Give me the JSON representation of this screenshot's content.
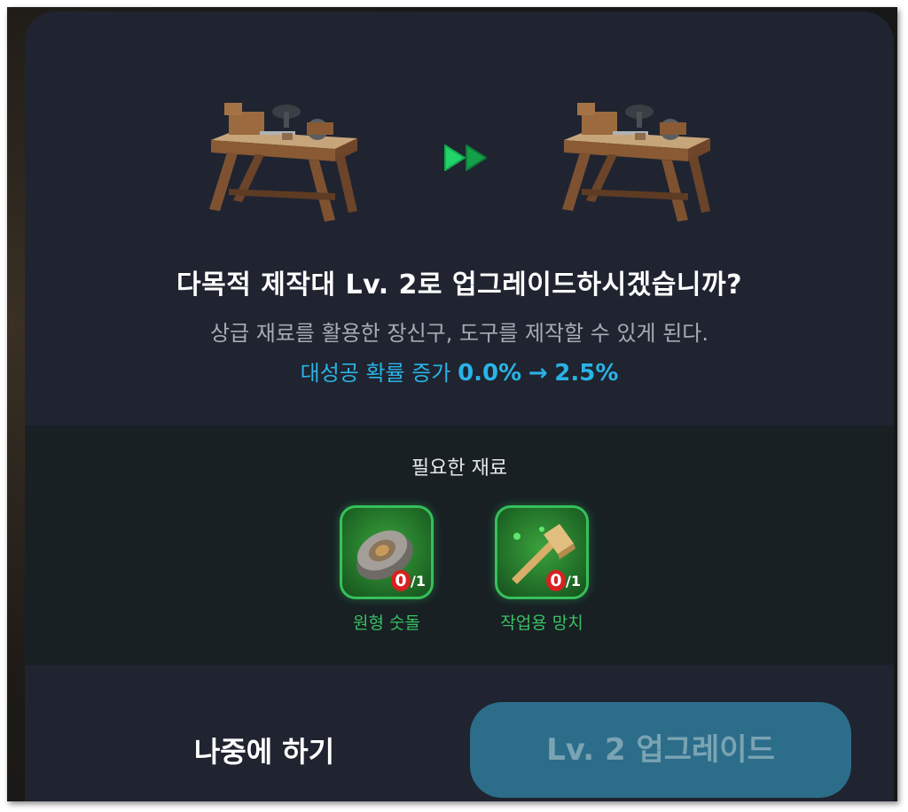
{
  "upgrade": {
    "title": "다목적 제작대 Lv. 2로 업그레이드하시겠습니까?",
    "description": "상급 재료를 활용한 장신구, 도구를 제작할 수 있게 된다.",
    "bonus_label": "대성공 확률 증가",
    "bonus_from": "0.0%",
    "bonus_arrow": "→",
    "bonus_to": "2.5%"
  },
  "materials": {
    "title": "필요한 재료",
    "items": [
      {
        "name": "원형 숫돌",
        "have": "0",
        "need": "/1",
        "icon": "whetstone-icon"
      },
      {
        "name": "작업용 망치",
        "have": "0",
        "need": "/1",
        "icon": "hammer-icon"
      }
    ]
  },
  "buttons": {
    "later": "나중에 하기",
    "upgrade": "Lv. 2 업그레이드"
  },
  "colors": {
    "dialog_bg": "#1f2430",
    "material_panel_bg": "#182024",
    "accent_blue": "#2ab3e6",
    "accent_green": "#35c15a",
    "upgrade_button": "#2c6d8a",
    "count_red": "#d82121"
  }
}
